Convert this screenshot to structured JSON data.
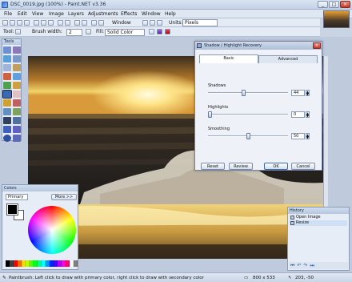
{
  "app": {
    "title": "DSC_0019.jpg (100%) - Paint.NET v3.36"
  },
  "window_controls": {
    "minimize": "_",
    "maximize": "□",
    "close": "×"
  },
  "menu": [
    "File",
    "Edit",
    "View",
    "Image",
    "Layers",
    "Adjustments",
    "Effects",
    "Window",
    "Help"
  ],
  "toolbar": {
    "window_label": "Window",
    "units_label": "Units:",
    "units_value": "Pixels",
    "tool_label": "Tool:",
    "brush_width_label": "Brush width:",
    "brush_width_value": "2",
    "fill_label": "Fill:",
    "fill_value": "Solid Color"
  },
  "tools_panel": {
    "title": "Tools"
  },
  "colors_panel": {
    "title": "Colors",
    "mode": "Primary",
    "more_button": "More >>",
    "primary_color": "#000000",
    "secondary_color": "#ffffff",
    "palette": [
      "#000000",
      "#404040",
      "#ff0000",
      "#ff6a00",
      "#ffd800",
      "#b6ff00",
      "#4cff00",
      "#00ff21",
      "#00ff90",
      "#00ffff",
      "#0094ff",
      "#0026ff",
      "#4800ff",
      "#b200ff",
      "#ff00dc",
      "#ff006e",
      "#ffffff",
      "#808080"
    ]
  },
  "dialog": {
    "title": "Shadow / Highlight Recovery",
    "close": "×",
    "tabs": [
      "Basic",
      "Advanced"
    ],
    "active_tab": "Basic",
    "params": [
      {
        "label": "Shadows",
        "value": "44",
        "level": 0.44
      },
      {
        "label": "Highlights",
        "value": "0",
        "level": 0.0
      },
      {
        "label": "Smoothing",
        "value": "50",
        "level": 0.5
      }
    ],
    "buttons": {
      "reset": "Reset",
      "review": "Review",
      "ok": "OK",
      "cancel": "Cancel"
    }
  },
  "history_panel": {
    "title": "History",
    "items": [
      "Open Image",
      "Resize"
    ]
  },
  "status": {
    "hint": "Paintbrush: Left click to draw with primary color, right click to draw with secondary color",
    "image_size": "800 x 533",
    "cursor_pos": "203, -50"
  }
}
